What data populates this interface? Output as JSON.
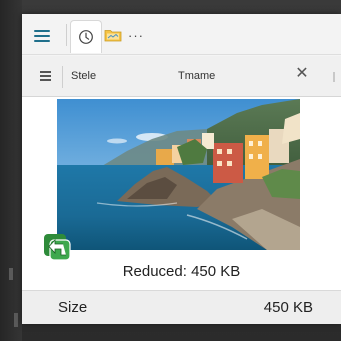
{
  "toolbar": {
    "menu_icon": "hamburger-icon",
    "tab_icon": "clock-icon",
    "folder_icon": "folder-icon",
    "more_label": "···"
  },
  "tab": {
    "left_label": "Stele",
    "center_label": "Tmame",
    "close_icon": "close-icon",
    "close_label": "✕"
  },
  "content": {
    "image_description": "coastal village photo",
    "badge_icon": "compress-arrow-icon",
    "reduced_label": "Reduced:",
    "reduced_value": "450 KB"
  },
  "footer": {
    "size_label": "Size",
    "size_value": "450 KB"
  },
  "colors": {
    "accent": "#1f6f8b",
    "badge_green": "#2e8b3a"
  }
}
